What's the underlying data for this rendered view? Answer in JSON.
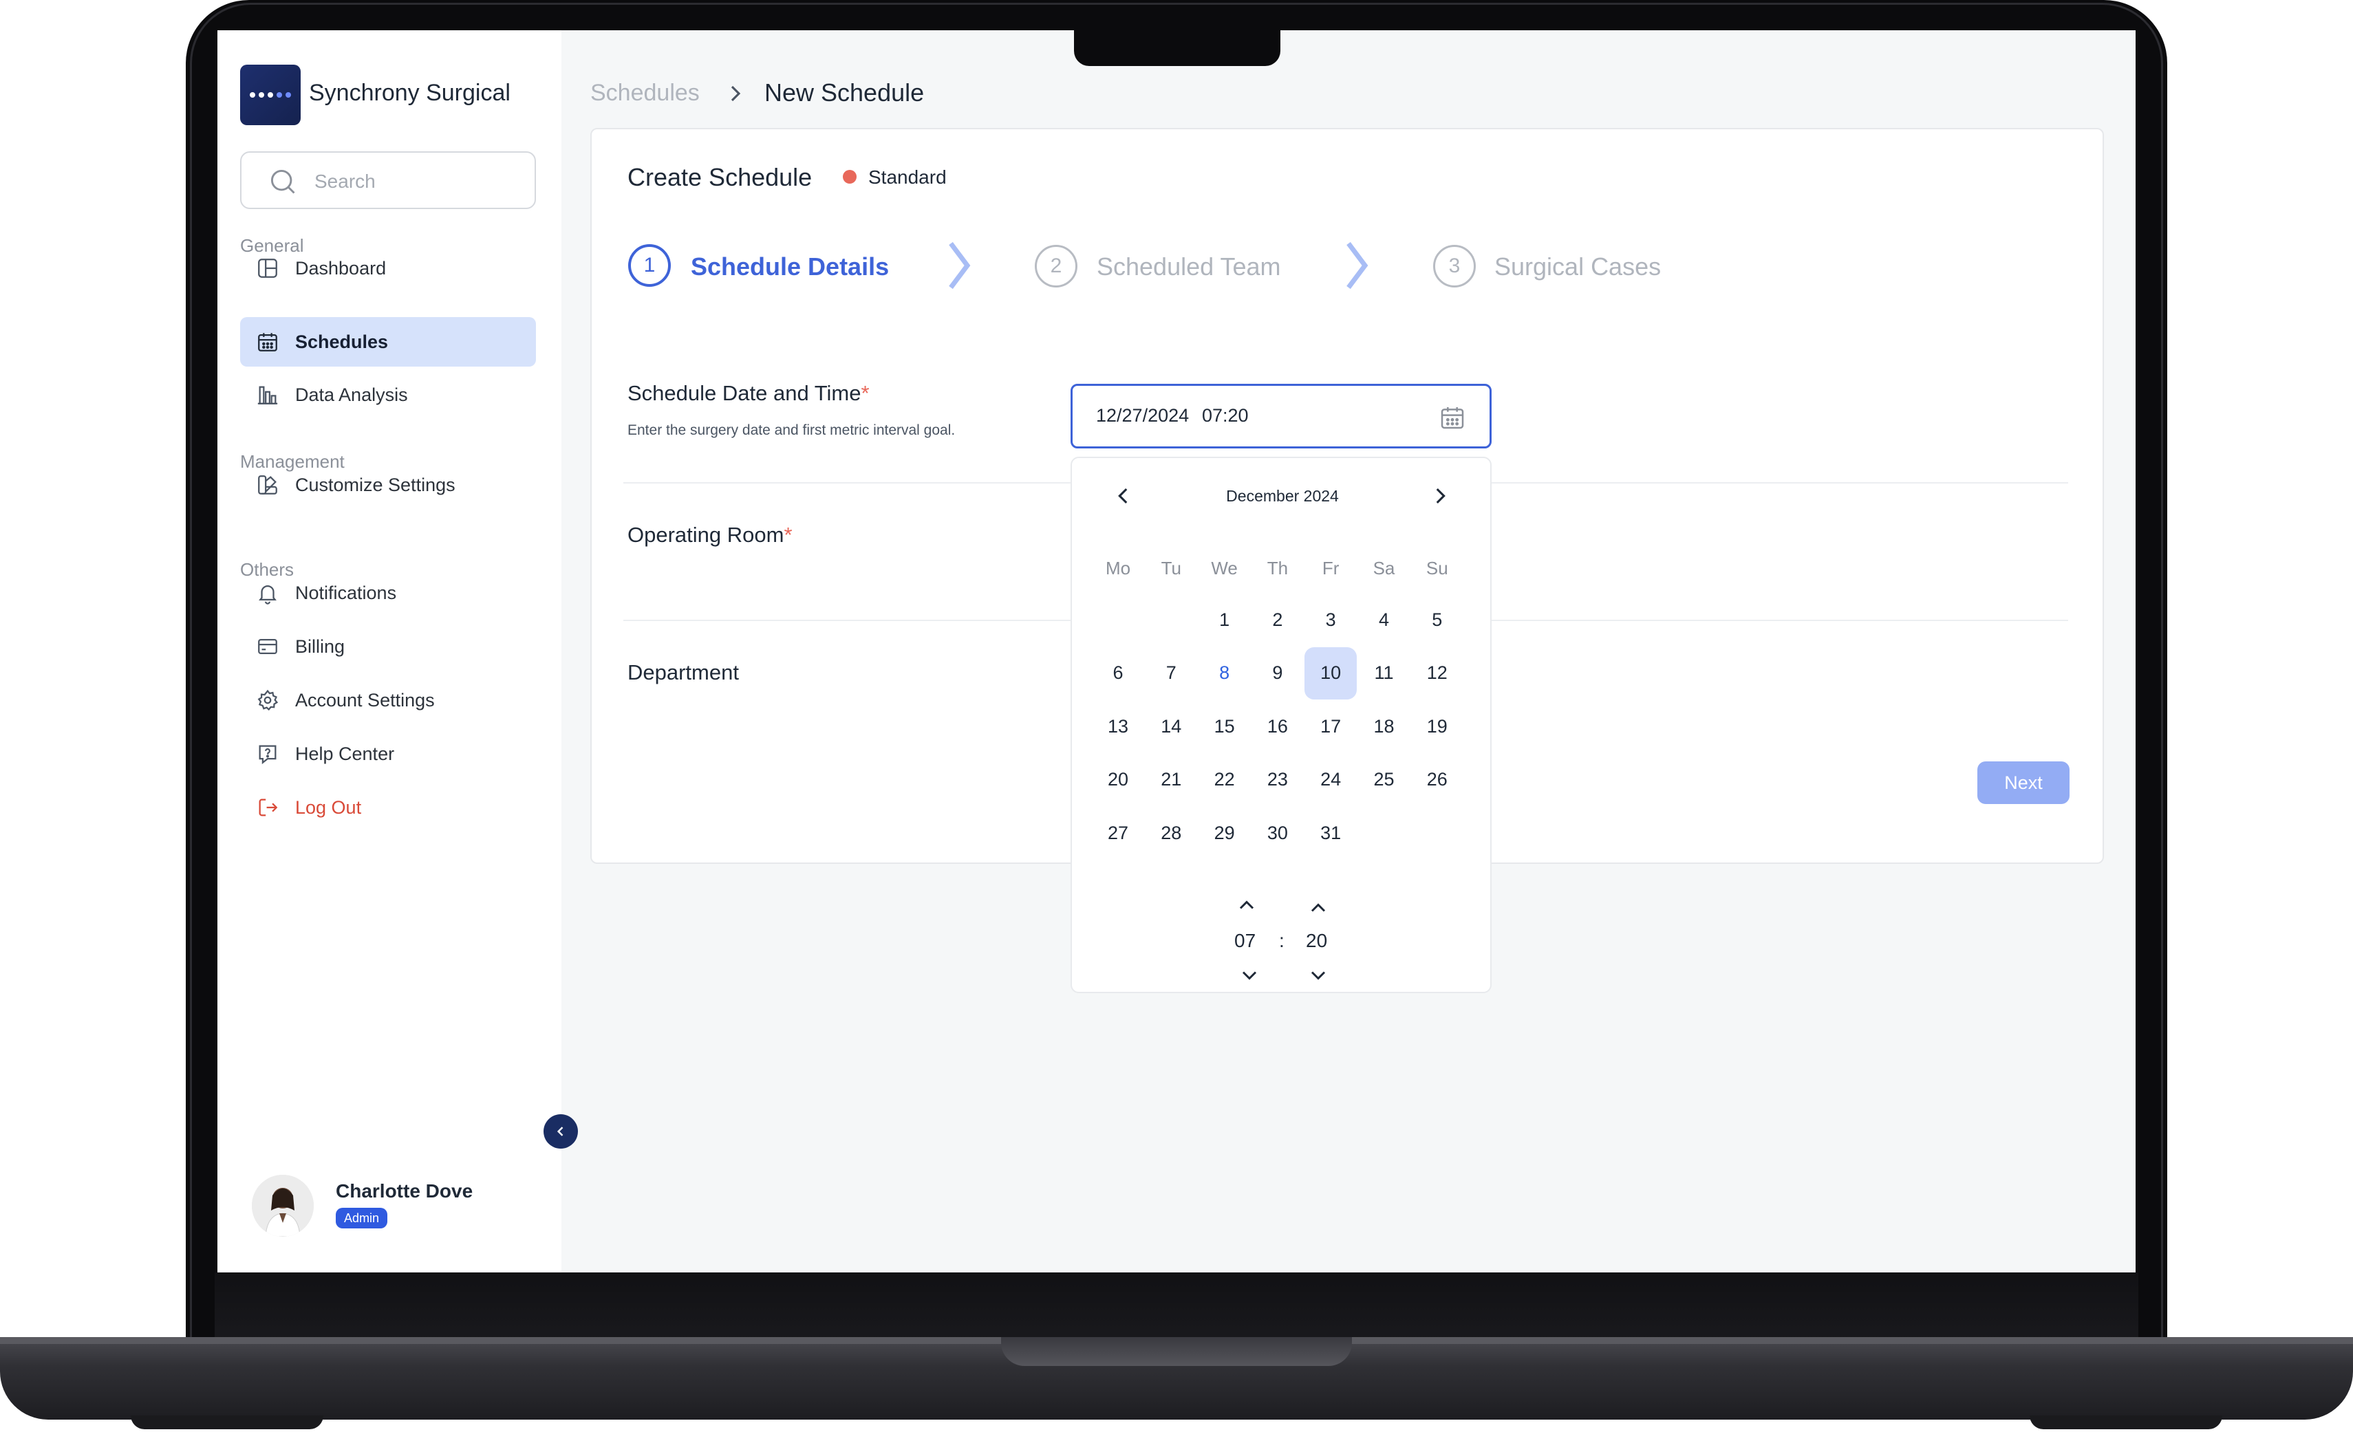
{
  "app": {
    "name": "Synchrony Surgical"
  },
  "search": {
    "placeholder": "Search"
  },
  "sidebar": {
    "sections": [
      {
        "title": "General",
        "items": [
          {
            "label": "Dashboard",
            "icon": "dashboard-icon"
          },
          {
            "label": "Schedules",
            "icon": "calendar-icon",
            "active": true
          },
          {
            "label": "Data Analysis",
            "icon": "bar-chart-icon"
          }
        ]
      },
      {
        "title": "Management",
        "items": [
          {
            "label": "Customize Settings",
            "icon": "customize-icon"
          }
        ]
      },
      {
        "title": "Others",
        "items": [
          {
            "label": "Notifications",
            "icon": "bell-icon"
          },
          {
            "label": "Billing",
            "icon": "card-icon"
          },
          {
            "label": "Account Settings",
            "icon": "gear-icon"
          },
          {
            "label": "Help Center",
            "icon": "help-icon"
          },
          {
            "label": "Log Out",
            "icon": "logout-icon"
          }
        ]
      }
    ]
  },
  "user": {
    "name": "Charlotte Dove",
    "role": "Admin"
  },
  "breadcrumb": {
    "parent": "Schedules",
    "current": "New Schedule"
  },
  "card": {
    "title": "Create Schedule",
    "badge": "Standard"
  },
  "steps": [
    {
      "number": "1",
      "label": "Schedule Details",
      "state": "active"
    },
    {
      "number": "2",
      "label": "Scheduled Team",
      "state": "upcoming"
    },
    {
      "number": "3",
      "label": "Surgical Cases",
      "state": "upcoming"
    }
  ],
  "form": {
    "schedule": {
      "label": "Schedule Date and Time",
      "required": "*",
      "hint": "Enter the surgery date and first metric interval goal.",
      "date": "12/27/2024",
      "time": "07:20"
    },
    "operating_room": {
      "label": "Operating Room",
      "required": "*"
    },
    "department": {
      "label": "Department"
    }
  },
  "picker": {
    "month": "December 2024",
    "weekdays": [
      "Mo",
      "Tu",
      "We",
      "Th",
      "Fr",
      "Sa",
      "Su"
    ],
    "weeks": [
      [
        "",
        "",
        "1",
        "2",
        "3",
        "4",
        "5"
      ],
      [
        "6",
        "7",
        "8",
        "9",
        "10",
        "11",
        "12"
      ],
      [
        "13",
        "14",
        "15",
        "16",
        "17",
        "18",
        "19"
      ],
      [
        "20",
        "21",
        "22",
        "23",
        "24",
        "25",
        "26"
      ],
      [
        "27",
        "28",
        "29",
        "30",
        "31",
        "",
        ""
      ]
    ],
    "today": "8",
    "selected": "10",
    "hour": "07",
    "minute": "20",
    "separator": ":"
  },
  "actions": {
    "next": "Next"
  },
  "colors": {
    "accent": "#3e63d8",
    "active_nav": "#d6e2fb",
    "logout": "#d94a38",
    "badge_dot": "#e8685a",
    "next_button": "#93acf4"
  }
}
